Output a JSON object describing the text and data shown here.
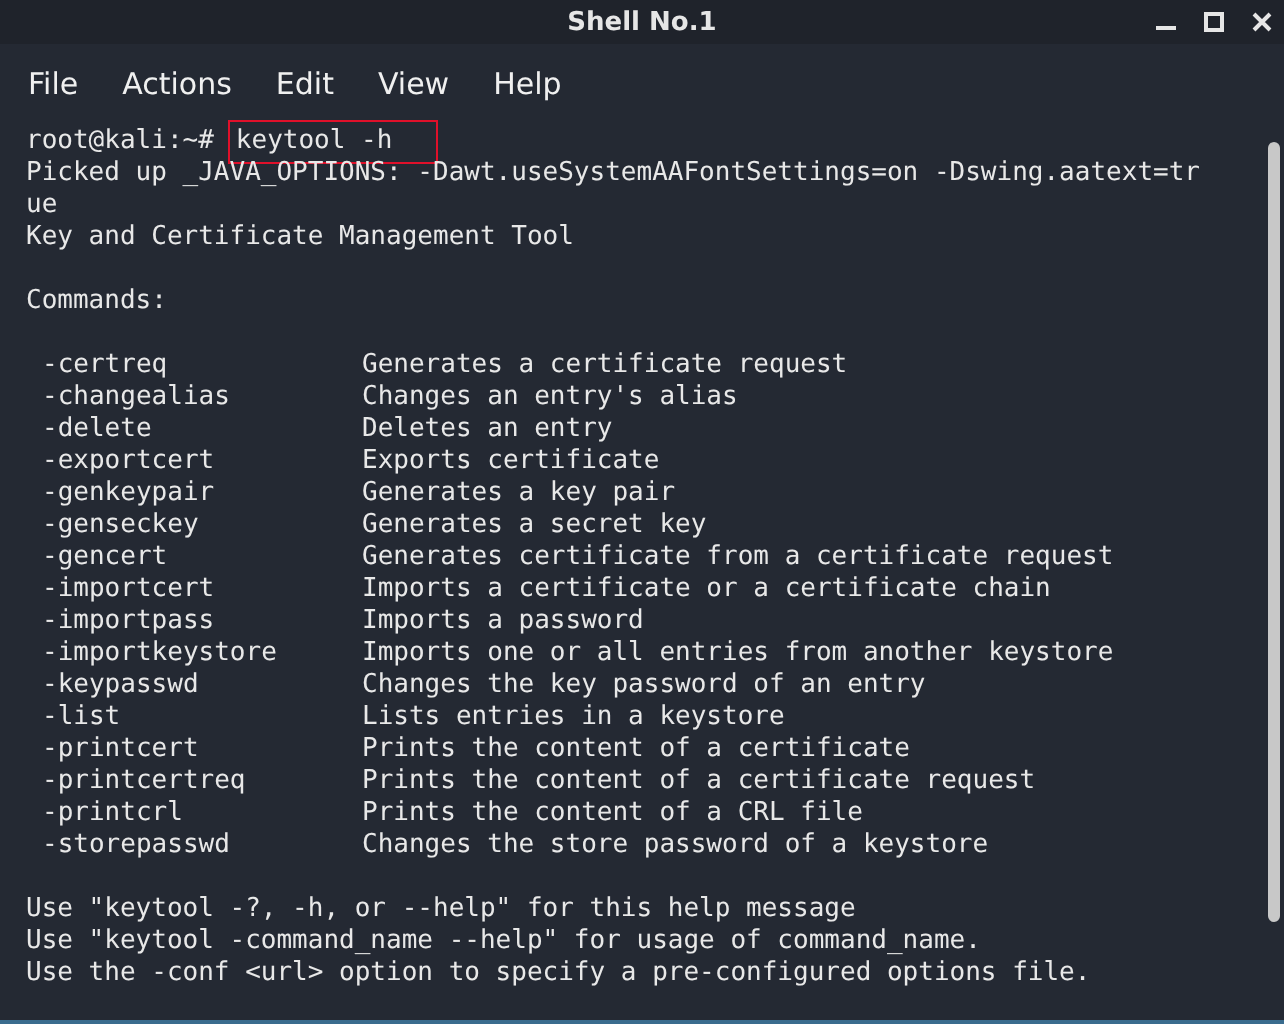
{
  "window": {
    "title": "Shell No.1"
  },
  "menu": [
    "File",
    "Actions",
    "Edit",
    "View",
    "Help"
  ],
  "terminal": {
    "prompt": "root@kali:~#",
    "command": "keytool -h",
    "command_highlighted": true,
    "output_lines": [
      "Picked up _JAVA_OPTIONS: -Dawt.useSystemAAFontSettings=on -Dswing.aatext=tr",
      "ue",
      "Key and Certificate Management Tool"
    ],
    "heading": "Commands:",
    "commands": [
      {
        "name": "-certreq",
        "description": "Generates a certificate request"
      },
      {
        "name": "-changealias",
        "description": "Changes an entry's alias"
      },
      {
        "name": "-delete",
        "description": "Deletes an entry"
      },
      {
        "name": "-exportcert",
        "description": "Exports certificate"
      },
      {
        "name": "-genkeypair",
        "description": "Generates a key pair"
      },
      {
        "name": "-genseckey",
        "description": "Generates a secret key"
      },
      {
        "name": "-gencert",
        "description": "Generates certificate from a certificate request"
      },
      {
        "name": "-importcert",
        "description": "Imports a certificate or a certificate chain"
      },
      {
        "name": "-importpass",
        "description": "Imports a password"
      },
      {
        "name": "-importkeystore",
        "description": "Imports one or all entries from another keystore"
      },
      {
        "name": "-keypasswd",
        "description": "Changes the key password of an entry"
      },
      {
        "name": "-list",
        "description": "Lists entries in a keystore"
      },
      {
        "name": "-printcert",
        "description": "Prints the content of a certificate"
      },
      {
        "name": "-printcertreq",
        "description": "Prints the content of a certificate request"
      },
      {
        "name": "-printcrl",
        "description": "Prints the content of a CRL file"
      },
      {
        "name": "-storepasswd",
        "description": "Changes the store password of a keystore"
      }
    ],
    "footer_lines": [
      "Use \"keytool -?, -h, or --help\" for this help message",
      "Use \"keytool -command_name --help\" for usage of command_name.",
      "Use the -conf <url> option to specify a pre-configured options file."
    ]
  }
}
